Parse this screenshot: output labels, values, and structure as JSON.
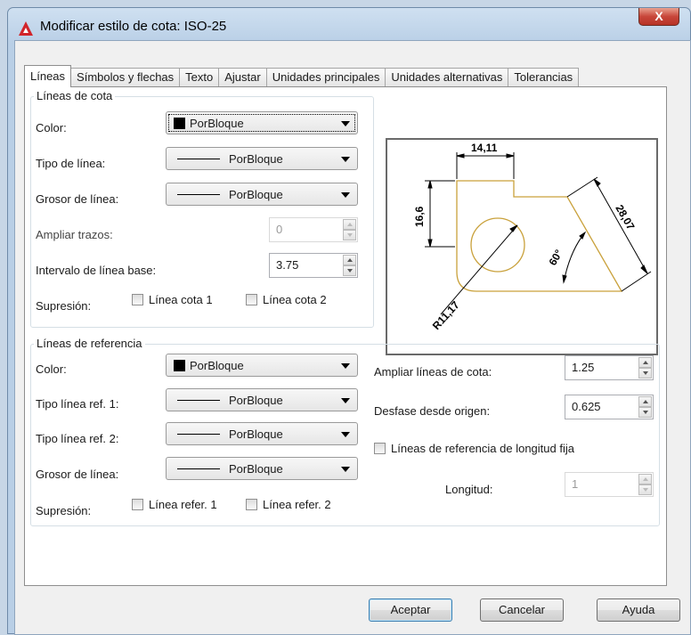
{
  "window": {
    "title": "Modificar estilo de cota: ISO-25",
    "close_label": "X"
  },
  "tabs": [
    "Líneas",
    "Símbolos y flechas",
    "Texto",
    "Ajustar",
    "Unidades principales",
    "Unidades alternativas",
    "Tolerancias"
  ],
  "active_tab": "Líneas",
  "dim_lines": {
    "group_label": "Líneas de cota",
    "color_label": "Color:",
    "color_value": "PorBloque",
    "linetype_label": "Tipo de línea:",
    "linetype_value": "PorBloque",
    "lineweight_label": "Grosor de línea:",
    "lineweight_value": "PorBloque",
    "extend_ticks_label": "Ampliar trazos:",
    "extend_ticks_value": "0",
    "baseline_spacing_label": "Intervalo de línea base:",
    "baseline_spacing_value": "3.75",
    "suppress_label": "Supresión:",
    "suppress_1_label": "Línea cota 1",
    "suppress_2_label": "Línea cota 2",
    "suppress_1_checked": false,
    "suppress_2_checked": false
  },
  "ext_lines": {
    "group_label": "Líneas de referencia",
    "color_label": "Color:",
    "color_value": "PorBloque",
    "linetype1_label": "Tipo línea ref. 1:",
    "linetype1_value": "PorBloque",
    "linetype2_label": "Tipo línea ref. 2:",
    "linetype2_value": "PorBloque",
    "lineweight_label": "Grosor de línea:",
    "lineweight_value": "PorBloque",
    "suppress_label": "Supresión:",
    "suppress_1_label": "Línea refer. 1",
    "suppress_2_label": "Línea refer. 2",
    "extend_beyond_label": "Ampliar líneas de cota:",
    "extend_beyond_value": "1.25",
    "offset_label": "Desfase desde origen:",
    "offset_value": "0.625",
    "fixed_length_label": "Líneas de referencia de longitud fija",
    "fixed_length_checked": false,
    "length_label": "Longitud:",
    "length_value": "1"
  },
  "preview": {
    "dim_top": "14,11",
    "dim_left": "16,6",
    "dim_right": "28,07",
    "angle": "60°",
    "radius": "R11,17"
  },
  "buttons": {
    "ok": "Aceptar",
    "cancel": "Cancelar",
    "help": "Ayuda"
  },
  "colors": {
    "shape_stroke": "#c9a13b",
    "dimension": "#000000"
  }
}
